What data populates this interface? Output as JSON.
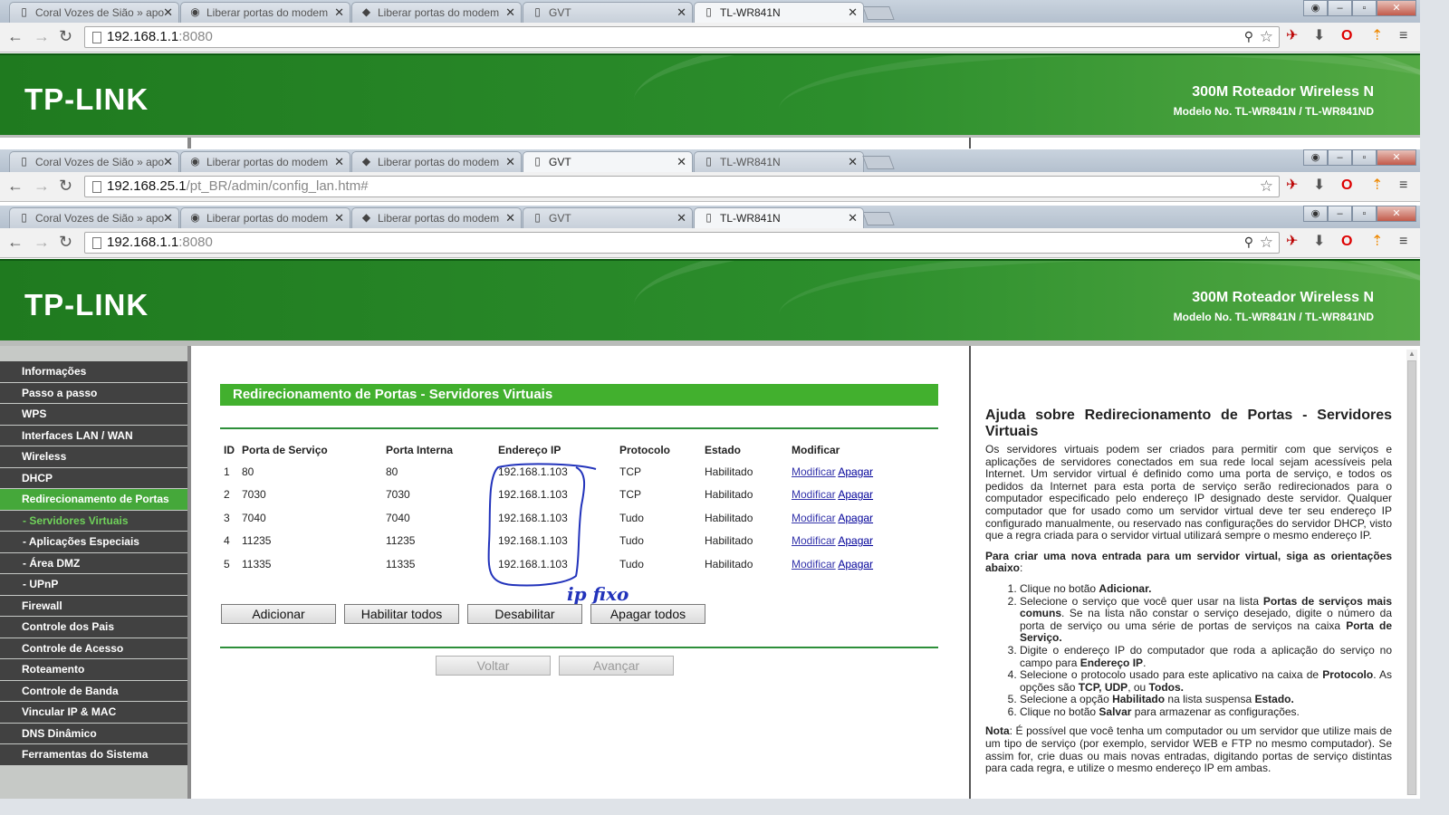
{
  "browser": {
    "tabs_a": [
      {
        "title": "Coral Vozes de Sião » apo",
        "icon": "page-icon"
      },
      {
        "title": "Liberar portas do modem",
        "icon": "globe-icon"
      },
      {
        "title": "Liberar portas do modem",
        "icon": "diamond-icon"
      },
      {
        "title": "GVT",
        "icon": "page-icon"
      },
      {
        "title": "TL-WR841N",
        "icon": "page-icon"
      }
    ],
    "url_local": "192.168.1.1",
    "url_port": ":8080",
    "url_gvt_host": "192.168.25.1",
    "url_gvt_path": "/pt_BR/admin/config_lan.htm#"
  },
  "banner": {
    "logo": "TP-LINK",
    "product": "300M Roteador Wireless N",
    "model": "Modelo No. TL-WR841N / TL-WR841ND"
  },
  "sidebar": {
    "items": [
      {
        "label": "Informações"
      },
      {
        "label": "Passo a passo"
      },
      {
        "label": "WPS"
      },
      {
        "label": "Interfaces LAN / WAN"
      },
      {
        "label": "Wireless"
      },
      {
        "label": "DHCP"
      },
      {
        "label": "Redirecionamento de Portas"
      },
      {
        "label": "- Servidores Virtuais"
      },
      {
        "label": "- Aplicações Especiais"
      },
      {
        "label": "- Área DMZ"
      },
      {
        "label": "- UPnP"
      },
      {
        "label": "Firewall"
      },
      {
        "label": "Controle dos Pais"
      },
      {
        "label": "Controle de Acesso"
      },
      {
        "label": "Roteamento"
      },
      {
        "label": "Controle de Banda"
      },
      {
        "label": "Vincular IP & MAC"
      },
      {
        "label": "DNS Dinâmico"
      },
      {
        "label": "Ferramentas do Sistema"
      }
    ]
  },
  "main": {
    "title": "Redirecionamento de Portas - Servidores Virtuais",
    "columns": [
      "ID",
      "Porta de Serviço",
      "Porta Interna",
      "Endereço IP",
      "Protocolo",
      "Estado",
      "Modificar"
    ],
    "rows": [
      {
        "id": "1",
        "service_port": "80",
        "internal_port": "80",
        "ip": "192.168.1.103",
        "protocol": "TCP",
        "status": "Habilitado"
      },
      {
        "id": "2",
        "service_port": "7030",
        "internal_port": "7030",
        "ip": "192.168.1.103",
        "protocol": "TCP",
        "status": "Habilitado"
      },
      {
        "id": "3",
        "service_port": "7040",
        "internal_port": "7040",
        "ip": "192.168.1.103",
        "protocol": "Tudo",
        "status": "Habilitado"
      },
      {
        "id": "4",
        "service_port": "11235",
        "internal_port": "11235",
        "ip": "192.168.1.103",
        "protocol": "Tudo",
        "status": "Habilitado"
      },
      {
        "id": "5",
        "service_port": "11335",
        "internal_port": "11335",
        "ip": "192.168.1.103",
        "protocol": "Tudo",
        "status": "Habilitado"
      }
    ],
    "modify_label": "Modificar",
    "delete_label": "Apagar",
    "annotation": "ip fixo",
    "buttons": {
      "add": "Adicionar",
      "enable_all": "Habilitar todos",
      "disable": "Desabilitar",
      "delete_all": "Apagar todos",
      "back": "Voltar",
      "next": "Avançar"
    }
  },
  "help": {
    "title": "Ajuda sobre Redirecionamento de Portas - Servidores Virtuais",
    "intro": "Os servidores virtuais podem ser criados para permitir com que serviços e aplicações de servidores conectados em sua rede local sejam acessíveis pela Internet. Um servidor virtual é definido como uma porta de serviço, e todos os pedidos da Internet para esta porta de serviço serão redirecionados para o computador especificado pelo endereço IP designado deste servidor. Qualquer computador que for usado como um servidor virtual deve ter seu endereço IP configurado manualmente, ou reservado nas configurações do servidor DHCP, visto que a regra criada para o servidor virtual utilizará sempre o mesmo endereço IP.",
    "steps_heading": "Para criar uma nova entrada para um servidor virtual, siga as orientações abaixo",
    "step1_a": "Clique no botão ",
    "step1_b": "Adicionar.",
    "step2_a": "Selecione o serviço que você quer usar na lista ",
    "step2_b": "Portas de serviços mais comuns",
    "step2_c": ". Se na lista não constar o serviço desejado, digite o número da porta de serviço ou uma série de portas de serviços na caixa ",
    "step2_d": "Porta de Serviço.",
    "step3_a": "Digite o endereço IP do computador que roda a aplicação do serviço no campo para ",
    "step3_b": "Endereço IP",
    "step4_a": "Selecione o protocolo usado para este aplicativo na caixa de ",
    "step4_b": "Protocolo",
    "step4_c": ". As opções são ",
    "step4_d": "TCP, UDP",
    "step4_e": ", ou ",
    "step4_f": "Todos.",
    "step5_a": "Selecione a opção ",
    "step5_b": "Habilitado",
    "step5_c": " na lista suspensa ",
    "step5_d": "Estado.",
    "step6_a": "Clique no botão ",
    "step6_b": "Salvar",
    "step6_c": " para armazenar as configurações.",
    "note_label": "Nota",
    "note": ": É possível que você tenha um computador ou um servidor que utilize mais de um tipo de serviço (por exemplo, servidor WEB e FTP no mesmo computador). Se assim for, crie duas ou mais novas entradas, digitando portas de serviço distintas para cada regra, e utilize o mesmo endereço IP em ambas."
  },
  "colors": {
    "brand_green": "#2c8e2c",
    "title_bar": "#42b02e",
    "sidebar_active": "#45a83a",
    "annotation_ink": "#2233bb"
  }
}
